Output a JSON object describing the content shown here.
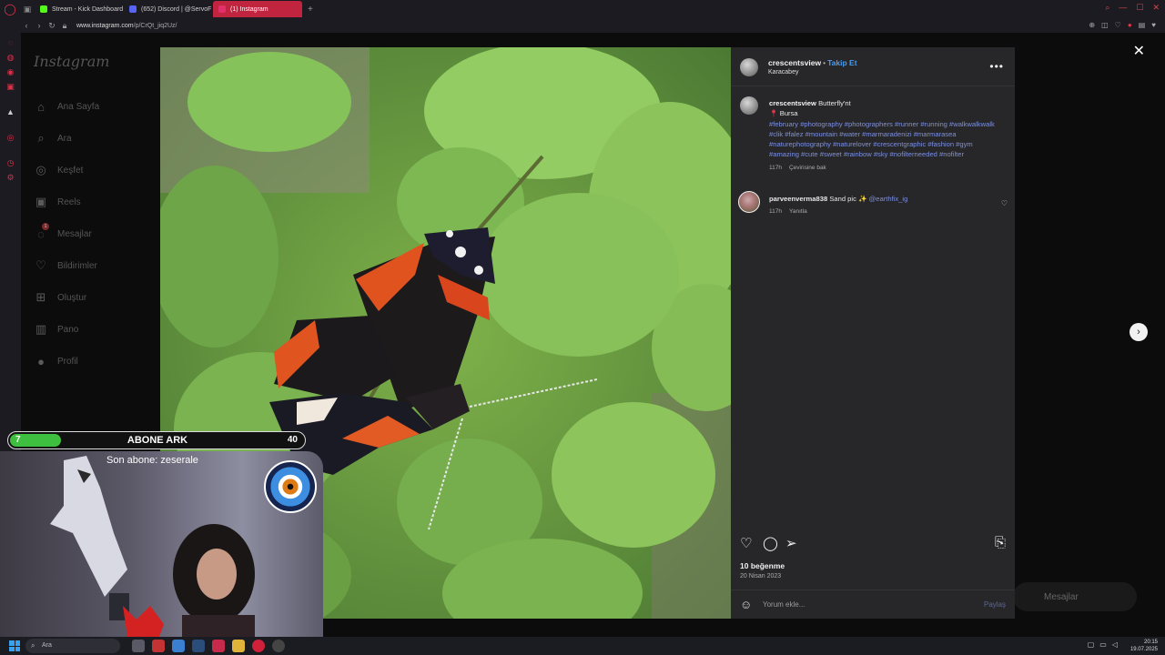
{
  "browser": {
    "tabs": [
      {
        "label": "Stream - Kick Dashboard",
        "color": "#53fc18"
      },
      {
        "label": "(652) Discord | @ServoF",
        "color": "#5865f2"
      },
      {
        "label": "(1) Instagram",
        "color": "#e1306c"
      }
    ],
    "url_host": "www.instagram.com",
    "url_path": "/p/CrQt_jiq2Uz/"
  },
  "instagram": {
    "logo": "Instagram",
    "nav": [
      {
        "label": "Ana Sayfa",
        "icon": "home-icon"
      },
      {
        "label": "Ara",
        "icon": "search-icon"
      },
      {
        "label": "Keşfet",
        "icon": "compass-icon"
      },
      {
        "label": "Reels",
        "icon": "reels-icon"
      },
      {
        "label": "Mesajlar",
        "icon": "messenger-icon"
      },
      {
        "label": "Bildirimler",
        "icon": "heart-icon"
      },
      {
        "label": "Oluştur",
        "icon": "plus-square-icon"
      },
      {
        "label": "Pano",
        "icon": "dashboard-icon"
      },
      {
        "label": "Profil",
        "icon": "avatar"
      }
    ],
    "messages_badge": "1",
    "post": {
      "username": "crescentsview",
      "follow_label": "Takip Et",
      "location": "Karacabey",
      "caption_text": "Butterfly'nt",
      "caption_place": "Bursa",
      "hashtags": "#february #photography #photographers #runner #running #walkwalkwalk #clik #falez #mountain #water #marmaradenizi #marmarasea #naturephotography #naturelover #crescentgraphic #fashion #gym #amazing #cute #sweet #rainbow #sky #nofilterneeded #nofilter",
      "caption_time": "117h",
      "translate_label": "Çevirisine bak",
      "comment": {
        "username": "parveenverma838",
        "text": "Sand pic",
        "mention": "@earthfix_ig",
        "time": "117h",
        "reply_label": "Yanıtla"
      },
      "likes": "10 beğenme",
      "date": "20 Nisan 2023",
      "comment_placeholder": "Yorum ekle...",
      "share_label": "Paylaş"
    },
    "dm_pill": "Mesajlar"
  },
  "overlay": {
    "goal_current": "7",
    "goal_label": "ABONE ARK",
    "goal_target": "40",
    "goal_progress": 0.175,
    "last_sub_label": "Son abone: zeserale"
  },
  "taskbar": {
    "search_placeholder": "Ara",
    "time": "20:15",
    "date": "19.07.2025"
  }
}
